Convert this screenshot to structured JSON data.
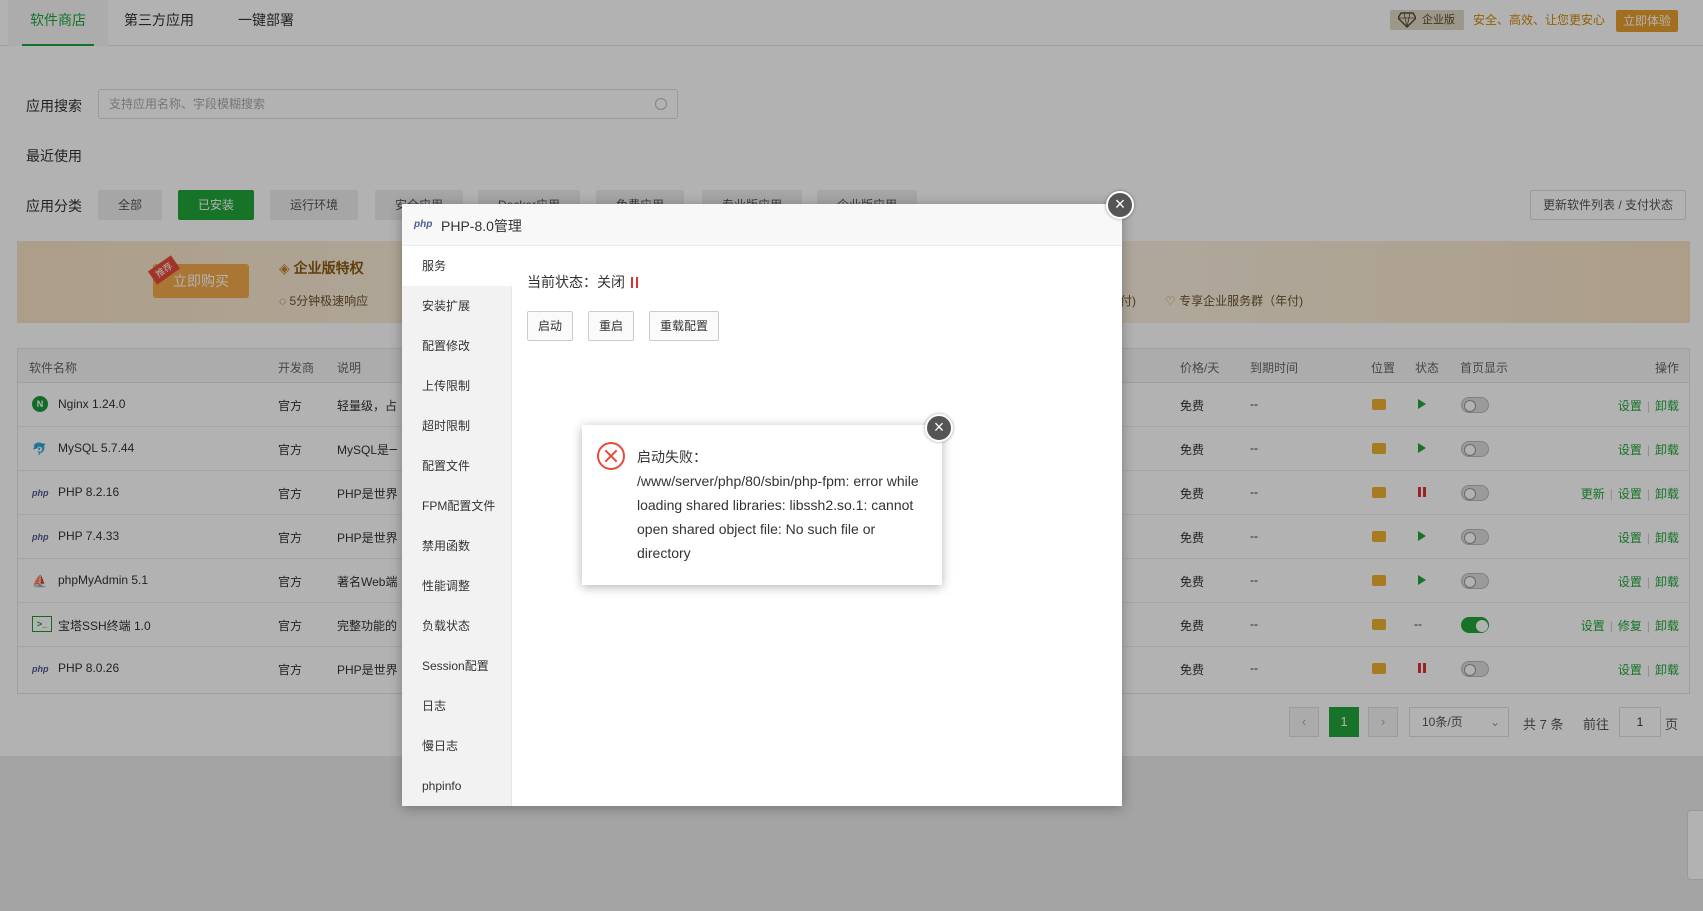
{
  "tabs": [
    "软件商店",
    "第三方应用",
    "一键部署"
  ],
  "enterprise": {
    "badge": "企业版",
    "slogan": "安全、高效、让您更安心",
    "try_label": "立即体验"
  },
  "search": {
    "label": "应用搜索",
    "placeholder": "支持应用名称、字段模糊搜索"
  },
  "recent_label": "最近使用",
  "category": {
    "label": "应用分类",
    "items": [
      "全部",
      "已安装",
      "运行环境",
      "安全应用",
      "Docker应用",
      "免费应用",
      "专业版应用",
      "企业版应用"
    ],
    "active": "已安装",
    "update_label": "更新软件列表 / 支付状态"
  },
  "banner": {
    "buy_label": "立即购买",
    "ribbon": "推荐",
    "title": "企业版特权",
    "features": [
      "5分钟极速响应",
      "付)",
      "专享企业服务群（年付)"
    ]
  },
  "table": {
    "headers": [
      "软件名称",
      "开发商",
      "说明",
      "价格/天",
      "到期时间",
      "位置",
      "状态",
      "首页显示",
      "操作"
    ],
    "rows": [
      {
        "icon": "N",
        "name": "Nginx 1.24.0",
        "dev": "官方",
        "desc": "轻量级，占有",
        "price": "免费",
        "expire": "--",
        "status": "play",
        "home": false,
        "ops": [
          "设置",
          "卸载"
        ]
      },
      {
        "icon": "🐬",
        "name": "MySQL 5.7.44",
        "dev": "官方",
        "desc": "MySQL是一",
        "price": "免费",
        "expire": "--",
        "status": "play",
        "home": false,
        "ops": [
          "设置",
          "卸载"
        ]
      },
      {
        "icon": "php",
        "name": "PHP 8.2.16",
        "dev": "官方",
        "desc": "PHP是世界上",
        "price": "免费",
        "expire": "--",
        "status": "pause",
        "home": false,
        "ops": [
          "更新",
          "设置",
          "卸载"
        ]
      },
      {
        "icon": "php",
        "name": "PHP 7.4.33",
        "dev": "官方",
        "desc": "PHP是世界上",
        "price": "免费",
        "expire": "--",
        "status": "play",
        "home": false,
        "ops": [
          "设置",
          "卸载"
        ]
      },
      {
        "icon": "⛵",
        "name": "phpMyAdmin 5.1",
        "dev": "官方",
        "desc": "著名Web端M",
        "price": "免费",
        "expire": "--",
        "status": "play",
        "home": false,
        "ops": [
          "设置",
          "卸载"
        ]
      },
      {
        "icon": ">_",
        "name": "宝塔SSH终端 1.0",
        "dev": "官方",
        "desc": "完整功能的S",
        "price": "免费",
        "expire": "--",
        "status": "dash",
        "home": true,
        "ops": [
          "设置",
          "修复",
          "卸载"
        ]
      },
      {
        "icon": "php",
        "name": "PHP 8.0.26",
        "dev": "官方",
        "desc": "PHP是世界上",
        "price": "免费",
        "expire": "--",
        "status": "pause",
        "home": false,
        "ops": [
          "设置",
          "卸载"
        ]
      }
    ]
  },
  "pager": {
    "current": "1",
    "size": "10条/页",
    "total": "共 7 条",
    "goto": "前往",
    "goto_value": "1",
    "page_unit": "页"
  },
  "dialog": {
    "logo": "php",
    "title": "PHP-8.0管理",
    "menu": [
      "服务",
      "安装扩展",
      "配置修改",
      "上传限制",
      "超时限制",
      "配置文件",
      "FPM配置文件",
      "禁用函数",
      "性能调整",
      "负载状态",
      "Session配置",
      "日志",
      "慢日志",
      "phpinfo"
    ],
    "status_label": "当前状态：",
    "status_value": "关闭",
    "buttons": [
      "启动",
      "重启",
      "重载配置"
    ]
  },
  "alert": {
    "message": "启动失败：\n/www/server/php/80/sbin/php-fpm: error while loading shared libraries: libssh2.so.1: cannot open shared object file: No such file or directory"
  },
  "colors": {
    "brand": "#20a53a",
    "danger": "#e84a3a",
    "gold": "#d48806"
  }
}
